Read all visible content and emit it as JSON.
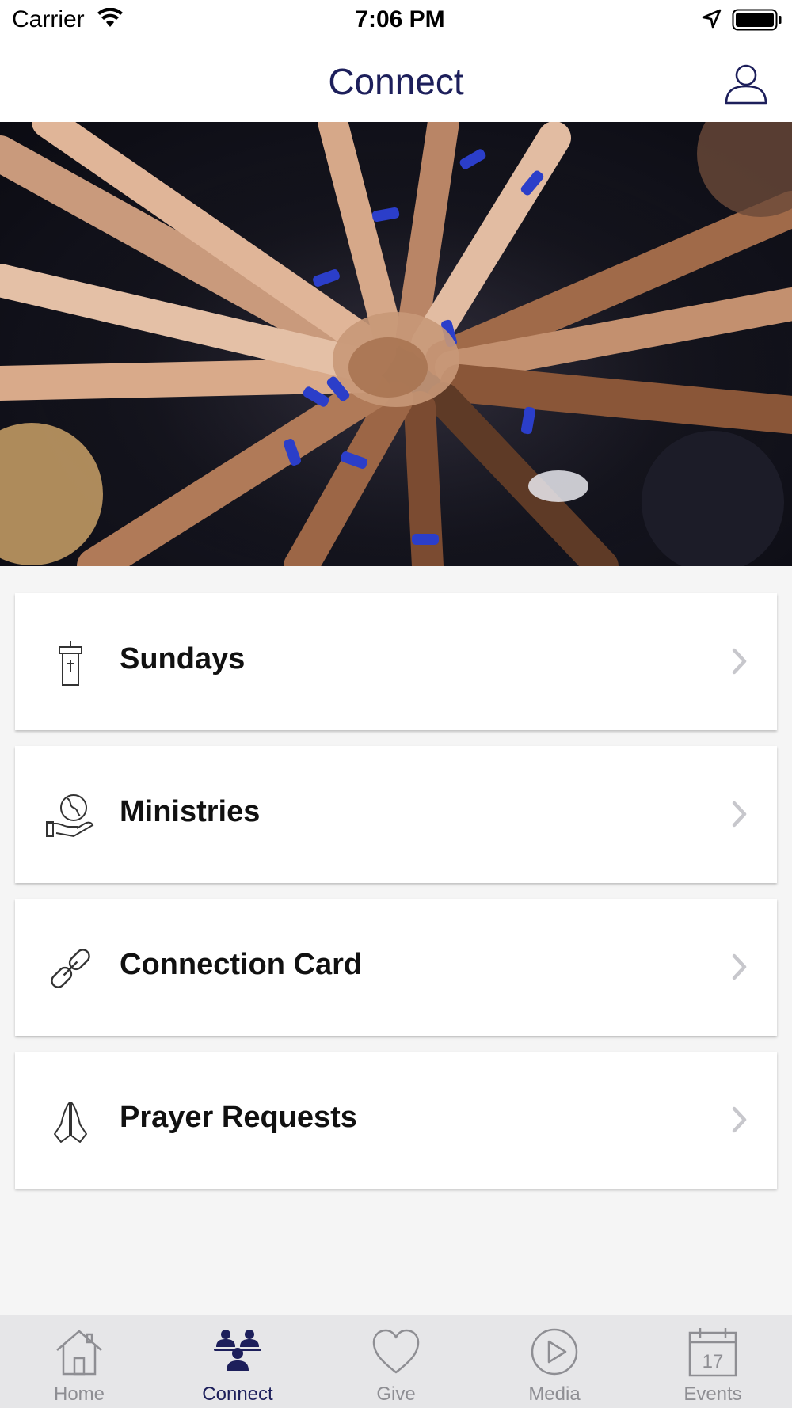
{
  "status_bar": {
    "carrier": "Carrier",
    "time": "7:06 PM"
  },
  "header": {
    "title": "Connect",
    "profile_icon": "person-outline-icon"
  },
  "hero": {
    "description_icon": "photo"
  },
  "menu": [
    {
      "label": "Sundays",
      "icon": "pulpit-icon"
    },
    {
      "label": "Ministries",
      "icon": "globe-in-hand-icon"
    },
    {
      "label": "Connection Card",
      "icon": "link-icon"
    },
    {
      "label": "Prayer Requests",
      "icon": "praying-hands-icon"
    }
  ],
  "tabs": [
    {
      "label": "Home",
      "icon": "home-icon",
      "active": false
    },
    {
      "label": "Connect",
      "icon": "people-icon",
      "active": true
    },
    {
      "label": "Give",
      "icon": "heart-icon",
      "active": false
    },
    {
      "label": "Media",
      "icon": "play-icon",
      "active": false
    },
    {
      "label": "Events",
      "icon": "calendar-icon",
      "active": false,
      "badge_text": "17"
    }
  ],
  "colors": {
    "brand": "#1d1f5b",
    "inactive": "#8e8e93",
    "chevron": "#c7c7cc"
  }
}
